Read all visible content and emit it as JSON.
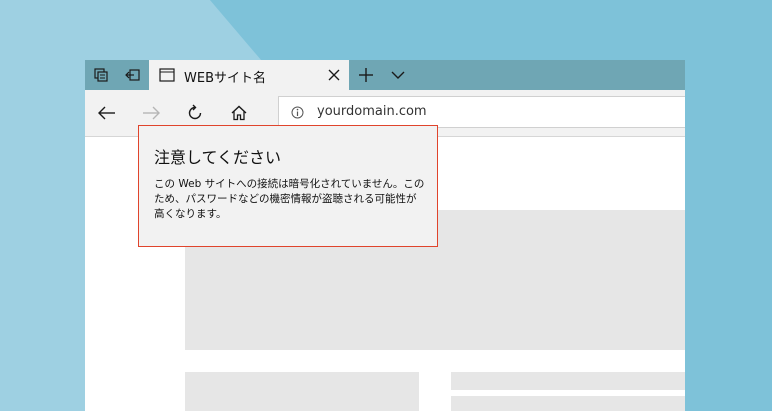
{
  "tab": {
    "title": "WEBサイト名",
    "close_icon": "close-icon",
    "new_tab_icon": "plus-icon",
    "tab_list_icon": "chevron-down-icon"
  },
  "tab_controls": [
    "tabs-aside-icon",
    "restore-tabs-icon"
  ],
  "navigation": {
    "back_icon": "back-arrow-icon",
    "forward_icon": "forward-arrow-icon",
    "refresh_icon": "refresh-icon",
    "home_icon": "home-icon"
  },
  "address_bar": {
    "url": "yourdomain.com",
    "site_info_icon": "info-icon"
  },
  "warning": {
    "title": "注意してください",
    "body": "この Web サイトへの接続は暗号化されていません。このため、パスワードなどの機密情報が盗聴される可能性が高くなります。"
  },
  "colors": {
    "tab_bar": "#6fa6b4",
    "chrome": "#f2f2f2",
    "warning_border": "#e0442c",
    "placeholder": "#e6e6e6",
    "desktop": "#8cc8dd"
  }
}
